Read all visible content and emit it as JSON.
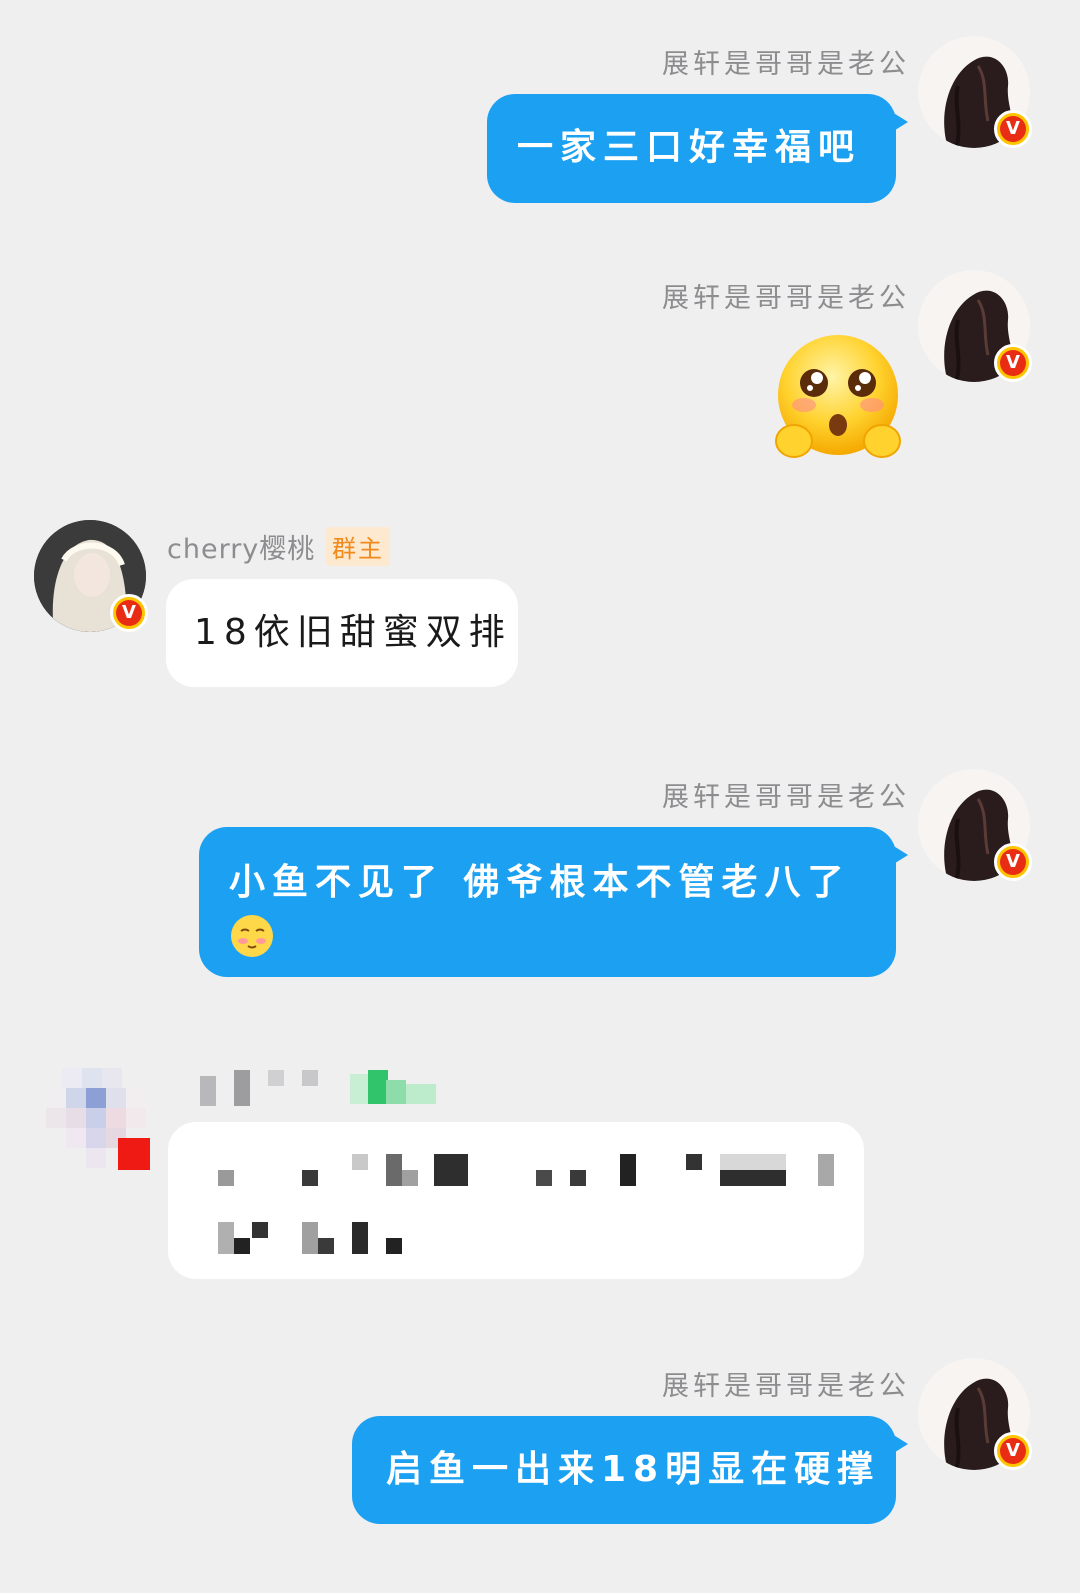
{
  "messages": [
    {
      "sender": "展轩是哥哥是老公",
      "text": "一家三口好幸福吧"
    },
    {
      "sender": "展轩是哥哥是老公",
      "emoji": "pleading-face-emoji"
    },
    {
      "sender": "cherry樱桃",
      "role_tag": "群主",
      "text": "18依旧甜蜜双排"
    },
    {
      "sender": "展轩是哥哥是老公",
      "text": "小鱼不见了 佛爷根本不管老八了",
      "emoji": "sleepy-face-emoji"
    },
    {
      "sender": "[pixelated]",
      "text": "[pixelated]"
    },
    {
      "sender": "展轩是哥哥是老公",
      "text": "启鱼一出来18明显在硬撑"
    }
  ],
  "badge_symbol": "V",
  "colors": {
    "outgoing_bubble": "#1ba0f2",
    "incoming_bubble": "#ffffff",
    "background": "#efeff0",
    "tag_bg": "#fde9cf",
    "tag_text": "#f08a1c"
  }
}
